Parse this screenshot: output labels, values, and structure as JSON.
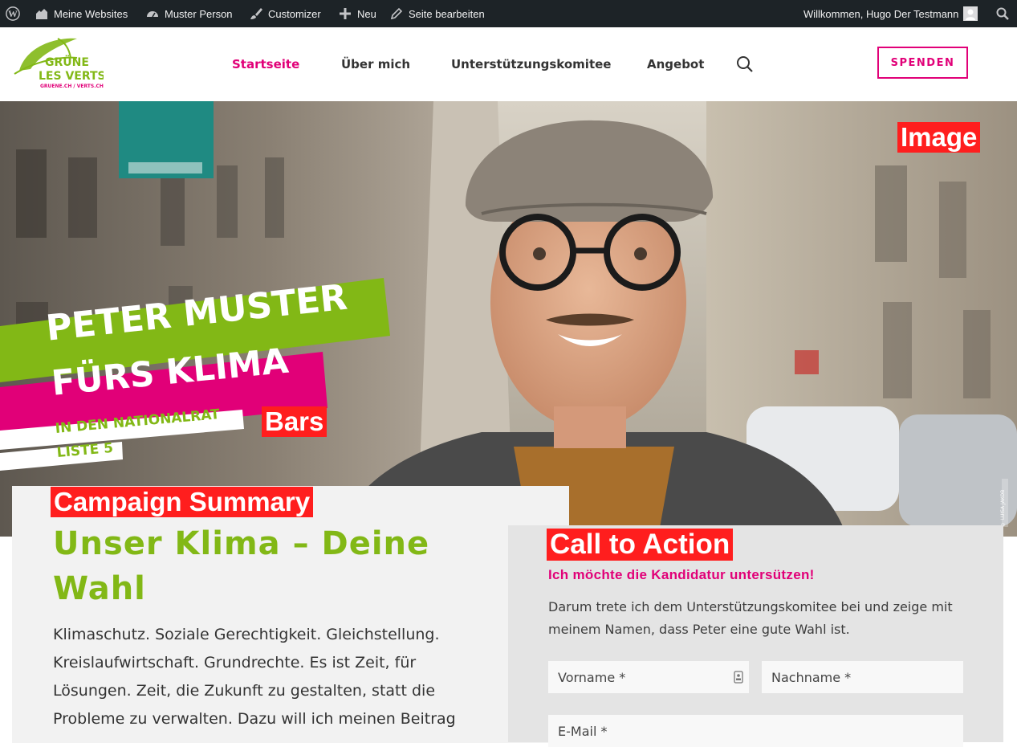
{
  "adminbar": {
    "wp_logo_icon": "wordpress-icon",
    "my_sites": "Meine Websites",
    "site_name": "Muster Person",
    "customizer": "Customizer",
    "new": "Neu",
    "edit_page": "Seite bearbeiten",
    "greeting": "Willkommen, Hugo Der Testmann"
  },
  "header": {
    "logo": {
      "line1": "GRÜNE",
      "line2": "LES VERTS",
      "line3": "GRUENE.CH / VERTS.CH"
    },
    "nav": [
      {
        "label": "Startseite",
        "active": true
      },
      {
        "label": "Über mich",
        "active": false
      },
      {
        "label": "Unterstützungskomitee",
        "active": false
      },
      {
        "label": "Angebot",
        "active": false
      }
    ],
    "donate_label": "SPENDEN"
  },
  "hero": {
    "image_tag": "Image",
    "bars_tag": "Bars",
    "bar1": "PETER MUSTER",
    "bar2": "FÜRS KLIMA",
    "bar3": "IN DEN NATIONALRAT",
    "bar4": "LISTE 5",
    "photo_credit": "© LUISA JAKOB"
  },
  "summary": {
    "tag": "Campaign Summary",
    "title": "Unser Klima – Deine Wahl",
    "body": "Klimaschutz. Soziale Gerechtigkeit. Gleichstellung. Kreislaufwirtschaft. Grundrechte. Es ist Zeit, für Lösungen. Zeit, die Zukunft zu gestalten, statt die Probleme zu verwalten. Dazu will ich meinen Beitrag"
  },
  "cta": {
    "tag": "Call to Action",
    "subtitle": "Ich möchte die Kandidatur untersützen!",
    "body": "Darum trete ich dem Unterstützungskomitee bei und zeige mit meinem Namen, dass Peter eine gute Wahl ist.",
    "firstname_placeholder": "Vorname *",
    "lastname_placeholder": "Nachname *",
    "email_placeholder": "E-Mail *"
  },
  "colors": {
    "green": "#82b816",
    "magenta": "#e10078",
    "adminbar": "#1d2327",
    "annotation": "#ff1e1e"
  }
}
